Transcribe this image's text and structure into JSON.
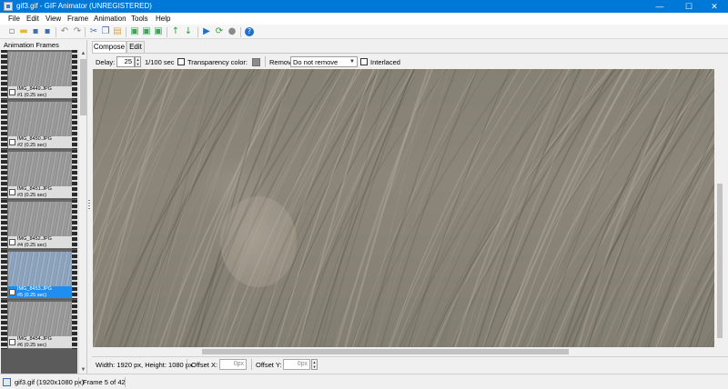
{
  "window": {
    "title": "gif3.gif - GIF Animator (UNREGISTERED)",
    "controls": {
      "minimize": "—",
      "maximize": "☐",
      "close": "✕"
    }
  },
  "menu": [
    "File",
    "Edit",
    "View",
    "Frame",
    "Animation",
    "Tools",
    "Help"
  ],
  "toolbar": {
    "buttons": [
      {
        "name": "new-icon",
        "color": "#ffffff"
      },
      {
        "name": "open-folder-icon",
        "color": "#e8b930"
      },
      {
        "name": "save-icon",
        "color": "#3b6fb5"
      },
      {
        "name": "save-as-icon",
        "color": "#3b6fb5"
      },
      {
        "name": "undo-icon",
        "color": "#8a8a8a"
      },
      {
        "name": "redo-icon",
        "color": "#8a8a8a"
      },
      {
        "name": "cut-icon",
        "color": "#3b6fb5"
      },
      {
        "name": "copy-icon",
        "color": "#3b6fb5"
      },
      {
        "name": "paste-icon",
        "color": "#d9a640"
      },
      {
        "name": "add-frame-icon",
        "color": "#3aa457"
      },
      {
        "name": "insert-frame-icon",
        "color": "#3aa457"
      },
      {
        "name": "delete-frame-icon",
        "color": "#3aa457"
      },
      {
        "name": "move-up-icon",
        "color": "#2e9e3d"
      },
      {
        "name": "move-down-icon",
        "color": "#2e9e3d"
      },
      {
        "name": "play-icon",
        "color": "#1f6fd1"
      },
      {
        "name": "loop-icon",
        "color": "#2e9e3d"
      },
      {
        "name": "stop-icon",
        "color": "#8a8a8a"
      },
      {
        "name": "help-icon",
        "color": "#1f6fd1"
      }
    ]
  },
  "frames_panel": {
    "header": "Animation Frames",
    "frames": [
      {
        "name": "IMG_8449.JPG",
        "info": "#1 (0.25 sec)",
        "selected": false
      },
      {
        "name": "IMG_8450.JPG",
        "info": "#2 (0.25 sec)",
        "selected": false
      },
      {
        "name": "IMG_8451.JPG",
        "info": "#3 (0.25 sec)",
        "selected": false
      },
      {
        "name": "IMG_8452.JPG",
        "info": "#4 (0.25 sec)",
        "selected": false
      },
      {
        "name": "IMG_8453.JPG",
        "info": "#5 (0.25 sec)",
        "selected": true
      },
      {
        "name": "IMG_8454.JPG",
        "info": "#6 (0.25 sec)",
        "selected": false
      }
    ]
  },
  "tabs": [
    "Compose",
    "Edit"
  ],
  "options": {
    "delay_label": "Delay:",
    "delay_value": "25",
    "delay_unit": "1/100 sec",
    "transparency_label": "Transparency color:",
    "transparency_color": "#8c8c8c",
    "removal_label": "Removal:",
    "removal_value": "Do not remove",
    "interlaced_label": "Interlaced"
  },
  "canvas": {
    "colors": {
      "base": "#8b8679",
      "streak_dark": "#5f5a50",
      "streak_light": "#b1aa9b"
    }
  },
  "info_row": {
    "dimensions": "Width: 1920 px, Height: 1080 px",
    "offset_x_label": "Offset X:",
    "offset_x_value": "0px",
    "offset_y_label": "Offset Y:",
    "offset_y_value": "0px"
  },
  "status": {
    "file": "gif3.gif (1920x1080 px)",
    "frame": "Frame 5 of 42"
  }
}
